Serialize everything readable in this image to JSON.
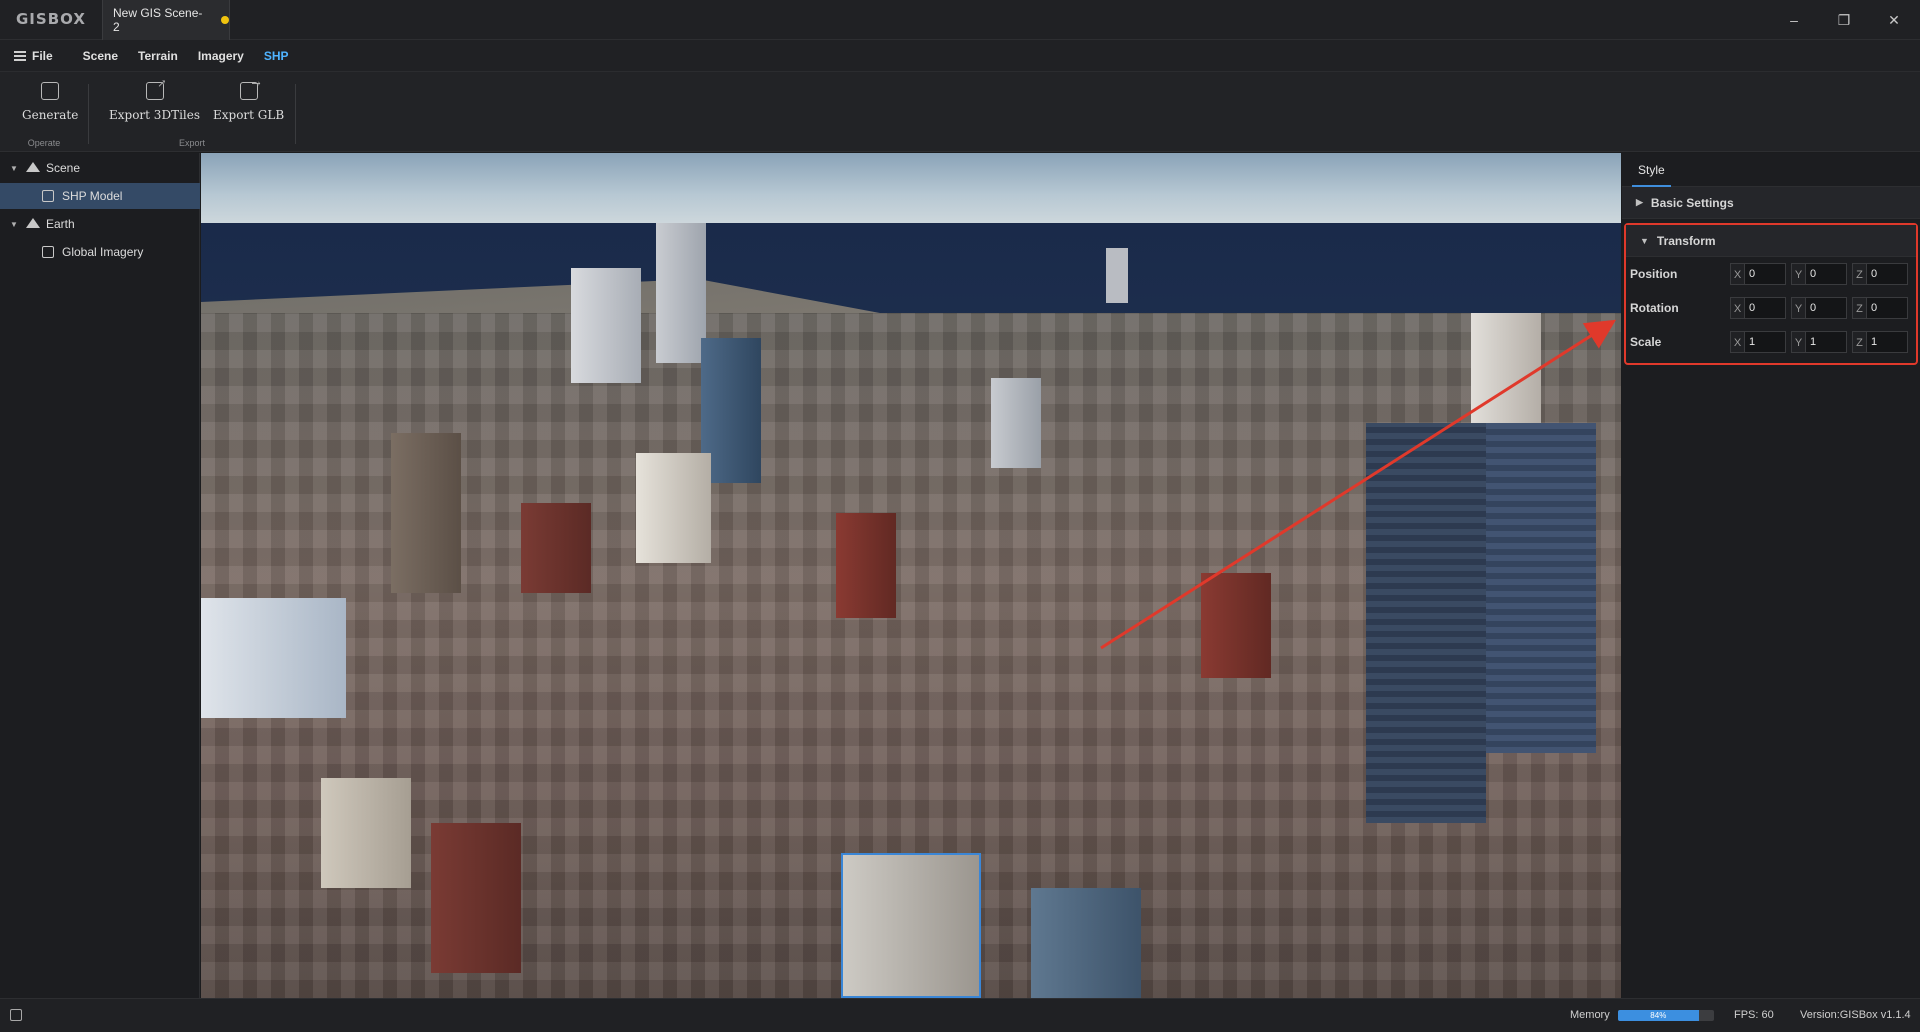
{
  "titlebar": {
    "logo": "GISBOX",
    "tab_title": "New GIS Scene-2",
    "minimize": "–",
    "restore": "❐",
    "close": "✕"
  },
  "menu": {
    "file": "File",
    "items": [
      "Scene",
      "Terrain",
      "Imagery",
      "SHP"
    ],
    "active": "SHP"
  },
  "ribbon": {
    "generate": "Generate",
    "operate_caption": "Operate",
    "export_3dtiles": "Export 3DTiles",
    "export_glb": "Export GLB",
    "export_caption": "Export"
  },
  "tree": {
    "items": [
      {
        "label": "Scene",
        "icon": "mountain-icon",
        "expanded": true
      },
      {
        "label": "SHP Model",
        "icon": "model-icon",
        "selected": true
      },
      {
        "label": "Earth",
        "icon": "mountain-icon",
        "expanded": true
      },
      {
        "label": "Global Imagery",
        "icon": "imagery-icon"
      }
    ]
  },
  "props": {
    "tab": "Style",
    "basic_settings": "Basic Settings",
    "transform": "Transform",
    "rows": [
      {
        "label": "Position",
        "x": "0",
        "y": "0",
        "z": "0"
      },
      {
        "label": "Rotation",
        "x": "0",
        "y": "0",
        "z": "0"
      },
      {
        "label": "Scale",
        "x": "1",
        "y": "1",
        "z": "1"
      }
    ],
    "axis_labels": {
      "x": "X",
      "y": "Y",
      "z": "Z"
    }
  },
  "status": {
    "memory_label": "Memory",
    "memory_percent": 84,
    "memory_text": "84%",
    "fps": "FPS: 60",
    "version": "Version:GISBox v1.1.4"
  },
  "colors": {
    "accent": "#3f8edc",
    "active_menu": "#4fb3ff",
    "highlight_box": "#e0392b",
    "unsaved_dot": "#f1c40f"
  }
}
